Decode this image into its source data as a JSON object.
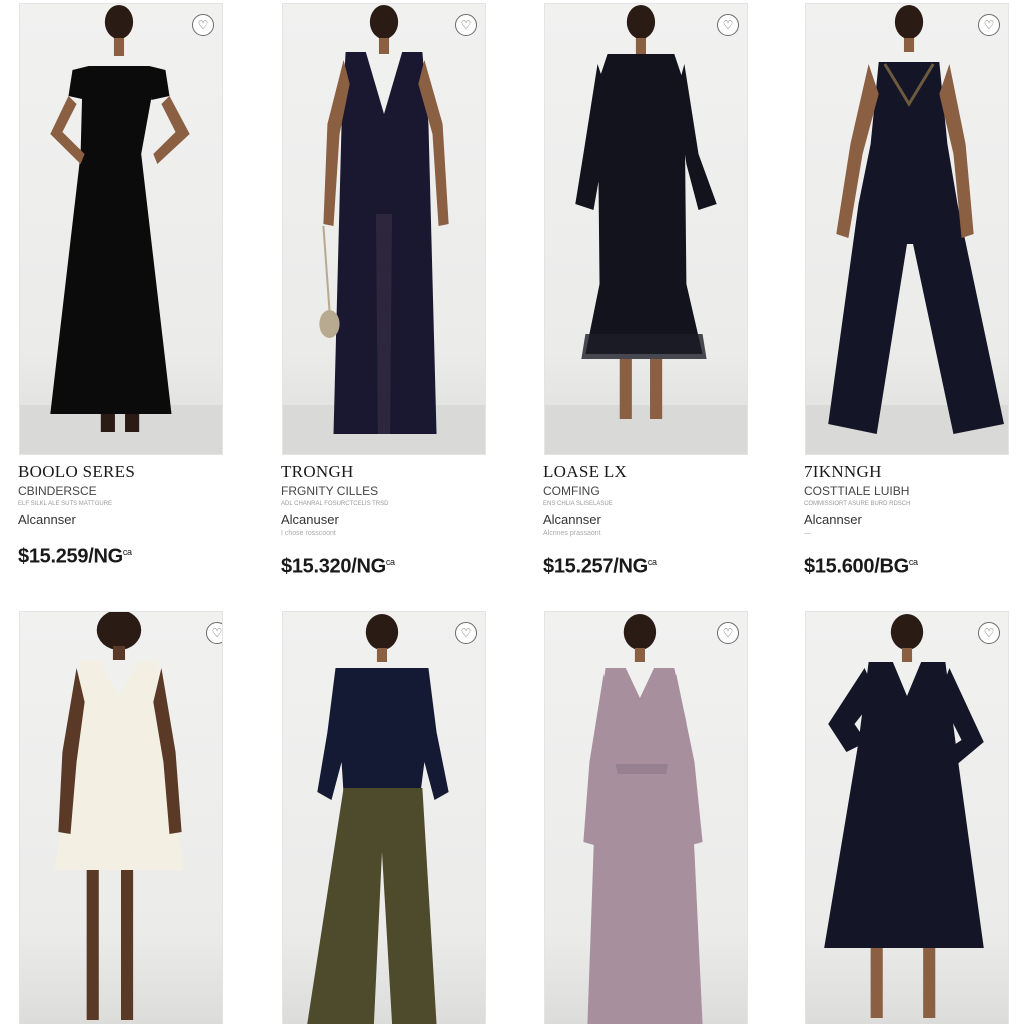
{
  "products": [
    {
      "title": "BOOLO SERES",
      "subtitle": "CBINDERSCE",
      "tiny": "ELF SILKL ALE SUTS MATTGURE",
      "vendor": "Alcannser",
      "vendor_sub": "",
      "price": "$15.259/NG",
      "price_sup": "ca",
      "fav_icon": "heart-icon",
      "dress_color": "#0b0b0c"
    },
    {
      "title": "TRONGH",
      "subtitle": "FRGNITY CILLES",
      "tiny": "ADL CHANRAL FOSURCTCELIS TRSD",
      "vendor": "Alcanuser",
      "vendor_sub": "I chose rosscoont",
      "price": "$15.320/NG",
      "price_sup": "ca",
      "fav_icon": "heart-icon",
      "dress_color": "#1a1830"
    },
    {
      "title": "LOASE LX",
      "subtitle": "COMFING",
      "tiny": "ENS CHLIA SLISELASUE",
      "vendor": "Alcannser",
      "vendor_sub": "Alcnnes prassaont",
      "price": "$15.257/NG",
      "price_sup": "ca",
      "fav_icon": "heart-icon",
      "dress_color": "#12131d"
    },
    {
      "title": "7IKNNGH",
      "subtitle": "COSTTIALE LUIBH",
      "tiny": "COMMISSIORT ASURE BURD RDSCH",
      "vendor": "Alcannser",
      "vendor_sub": "—",
      "price": "$15.600/BG",
      "price_sup": "ca",
      "fav_icon": "heart-icon",
      "dress_color": "#141526"
    },
    {
      "fav_icon": "heart-icon",
      "dress_color": "#f3efe2"
    },
    {
      "fav_icon": "heart-icon",
      "top_color": "#141a33",
      "pants_color": "#4e4a2c"
    },
    {
      "fav_icon": "heart-icon",
      "dress_color": "#a88f9e"
    },
    {
      "fav_icon": "heart-icon",
      "dress_color": "#141526"
    }
  ]
}
